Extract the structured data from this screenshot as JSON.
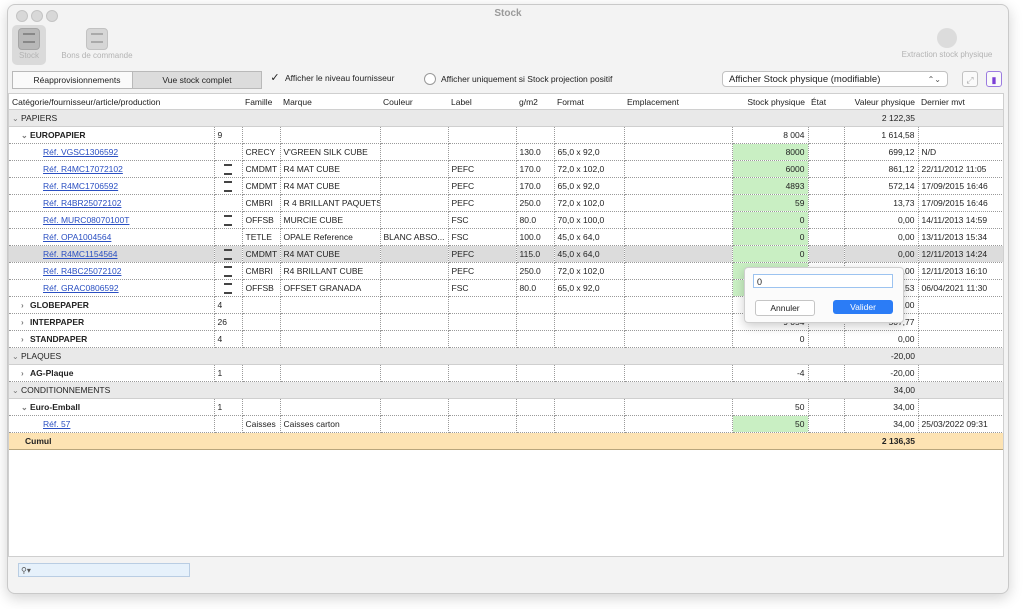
{
  "window": {
    "title": "Stock"
  },
  "toolbar": {
    "stock_label": "Stock",
    "bons_label": "Bons de commande",
    "extraction_label": "Extraction stock physique"
  },
  "options": {
    "tab_reappro": "Réapprovisionnements",
    "tab_vue": "Vue stock complet",
    "chk_fournisseur": "Afficher le niveau fournisseur",
    "chk_fournisseur_checked": true,
    "chk_projection": "Afficher uniquement si Stock projection positif",
    "chk_projection_checked": false,
    "dropdown_value": "Afficher Stock physique (modifiable)"
  },
  "columns": [
    "Catégorie/fournisseur/article/production",
    "",
    "Famille",
    "Marque",
    "Couleur",
    "Label",
    "g/m2",
    "Format",
    "Emplacement",
    "Stock physique",
    "État",
    "Valeur physique",
    "Dernier mvt"
  ],
  "rows": [
    {
      "type": "cat",
      "name": "PAPIERS",
      "valeur": "2 122,35"
    },
    {
      "type": "sup",
      "name": "EUROPAPIER",
      "count": "9",
      "stock": "8 004",
      "valeur": "1 614,58"
    },
    {
      "type": "art",
      "ref": "Réf. VGSC1306592",
      "icon": false,
      "famille": "CRECY",
      "marque": "V'GREEN SILK CUBE",
      "couleur": "",
      "label": "",
      "gm2": "130.0",
      "format": "65,0 x 92,0",
      "stock": "8000",
      "valeur": "699,12",
      "mvt": "N/D"
    },
    {
      "type": "art",
      "ref": "Réf. R4MC17072102",
      "icon": true,
      "famille": "CMDMT",
      "marque": "R4 MAT CUBE",
      "couleur": "",
      "label": "PEFC",
      "gm2": "170.0",
      "format": "72,0 x 102,0",
      "stock": "6000",
      "valeur": "861,12",
      "mvt": "22/11/2012 11:05"
    },
    {
      "type": "art",
      "ref": "Réf. R4MC1706592",
      "icon": true,
      "famille": "CMDMT",
      "marque": "R4 MAT CUBE",
      "couleur": "",
      "label": "PEFC",
      "gm2": "170.0",
      "format": "65,0 x 92,0",
      "stock": "4893",
      "valeur": "572,14",
      "mvt": "17/09/2015 16:46"
    },
    {
      "type": "art",
      "ref": "Réf. R4BR25072102",
      "icon": false,
      "famille": "CMBRI",
      "marque": "R 4 BRILLANT PAQUETS",
      "couleur": "",
      "label": "PEFC",
      "gm2": "250.0",
      "format": "72,0 x 102,0",
      "stock": "59",
      "valeur": "13,73",
      "mvt": "17/09/2015 16:46"
    },
    {
      "type": "art",
      "ref": "Réf. MURC08070100T",
      "icon": true,
      "famille": "OFFSB",
      "marque": "MURCIE CUBE",
      "couleur": "",
      "label": "FSC",
      "gm2": "80.0",
      "format": "70,0 x 100,0",
      "stock": "0",
      "valeur": "0,00",
      "mvt": "14/11/2013 14:59"
    },
    {
      "type": "art",
      "ref": "Réf. OPA1004564",
      "icon": false,
      "famille": "TETLE",
      "marque": "OPALE Reference",
      "couleur": "BLANC ABSO...",
      "label": "FSC",
      "gm2": "100.0",
      "format": "45,0 x 64,0",
      "stock": "0",
      "valeur": "0,00",
      "mvt": "13/11/2013 15:34"
    },
    {
      "type": "art",
      "ref": "Réf. R4MC1154564",
      "icon": true,
      "famille": "CMDMT",
      "marque": "R4 MAT CUBE",
      "couleur": "",
      "label": "PEFC",
      "gm2": "115.0",
      "format": "45,0 x 64,0",
      "stock": "0",
      "valeur": "0,00",
      "mvt": "12/11/2013 14:24",
      "selected": true
    },
    {
      "type": "art",
      "ref": "Réf. R4BC25072102",
      "icon": true,
      "famille": "CMBRI",
      "marque": "R4 BRILLANT CUBE",
      "couleur": "",
      "label": "PEFC",
      "gm2": "250.0",
      "format": "72,0 x 102,0",
      "stock": "",
      "valeur": "0,00",
      "mvt": "12/11/2013 16:10"
    },
    {
      "type": "art",
      "ref": "Réf. GRAC0806592",
      "icon": true,
      "famille": "OFFSB",
      "marque": "OFFSET GRANADA",
      "couleur": "",
      "label": "FSC",
      "gm2": "80.0",
      "format": "65,0 x 92,0",
      "stock": "",
      "valeur": "31,53",
      "mvt": "06/04/2021 11:30"
    },
    {
      "type": "sup",
      "name": "GLOBEPAPER",
      "count": "4",
      "stock": "",
      "valeur": "0,00"
    },
    {
      "type": "sup",
      "name": "INTERPAPER",
      "count": "26",
      "stock": "9 054",
      "valeur": "507,77"
    },
    {
      "type": "sup",
      "name": "STANDPAPER",
      "count": "4",
      "stock": "0",
      "valeur": "0,00"
    },
    {
      "type": "cat",
      "name": "PLAQUES",
      "valeur": "-20,00"
    },
    {
      "type": "sup",
      "name": "AG-Plaque",
      "count": "1",
      "stock": "-4",
      "valeur": "-20,00"
    },
    {
      "type": "cat",
      "name": "CONDITIONNEMENTS",
      "valeur": "34,00"
    },
    {
      "type": "sup",
      "name": "Euro-Emball",
      "count": "1",
      "stock": "50",
      "valeur": "34,00",
      "open": true
    },
    {
      "type": "art",
      "ref": "Réf. 57",
      "icon": false,
      "famille": "Caisses",
      "marque": "Caisses carton",
      "couleur": "",
      "label": "",
      "gm2": "",
      "format": "",
      "stock": "50",
      "valeur": "34,00",
      "mvt": "25/03/2022 09:31"
    }
  ],
  "cumul": {
    "label": "Cumul",
    "valeur": "2 136,35"
  },
  "popup": {
    "value": "0",
    "cancel": "Annuler",
    "ok": "Valider"
  },
  "colors": {
    "accent": "#2b7cf6",
    "stock_cell": "#c9efc3",
    "cumul_row": "#fde3b3",
    "link": "#2a4fc2"
  }
}
